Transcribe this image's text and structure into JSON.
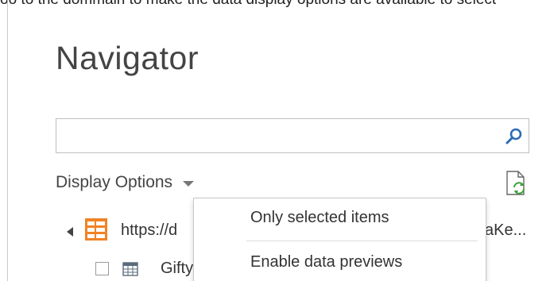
{
  "top_clip": {
    "text": "oo to the dommain to make the data display options are available to select"
  },
  "navigator": {
    "title": "Navigator",
    "search": {
      "value": "",
      "placeholder": ""
    },
    "display_options": {
      "label": "Display Options"
    }
  },
  "tree": {
    "source": {
      "label_left": "https://d",
      "label_right": "aKe..."
    },
    "items": [
      {
        "label": "Gifty"
      }
    ]
  },
  "dropdown": {
    "items": [
      {
        "label": "Only selected items"
      },
      {
        "label": "Enable data previews"
      }
    ]
  },
  "colors": {
    "search_icon": "#2b6cb5",
    "source_icon": "#f08326",
    "refresh_arrows": "#3da03d",
    "border": "#bfbfbf"
  },
  "icons": {
    "search": "search-icon",
    "caret": "chevron-down-icon",
    "refresh": "refresh-file-icon",
    "expand": "expand-triangle-icon",
    "source": "data-source-icon",
    "table": "table-icon"
  }
}
